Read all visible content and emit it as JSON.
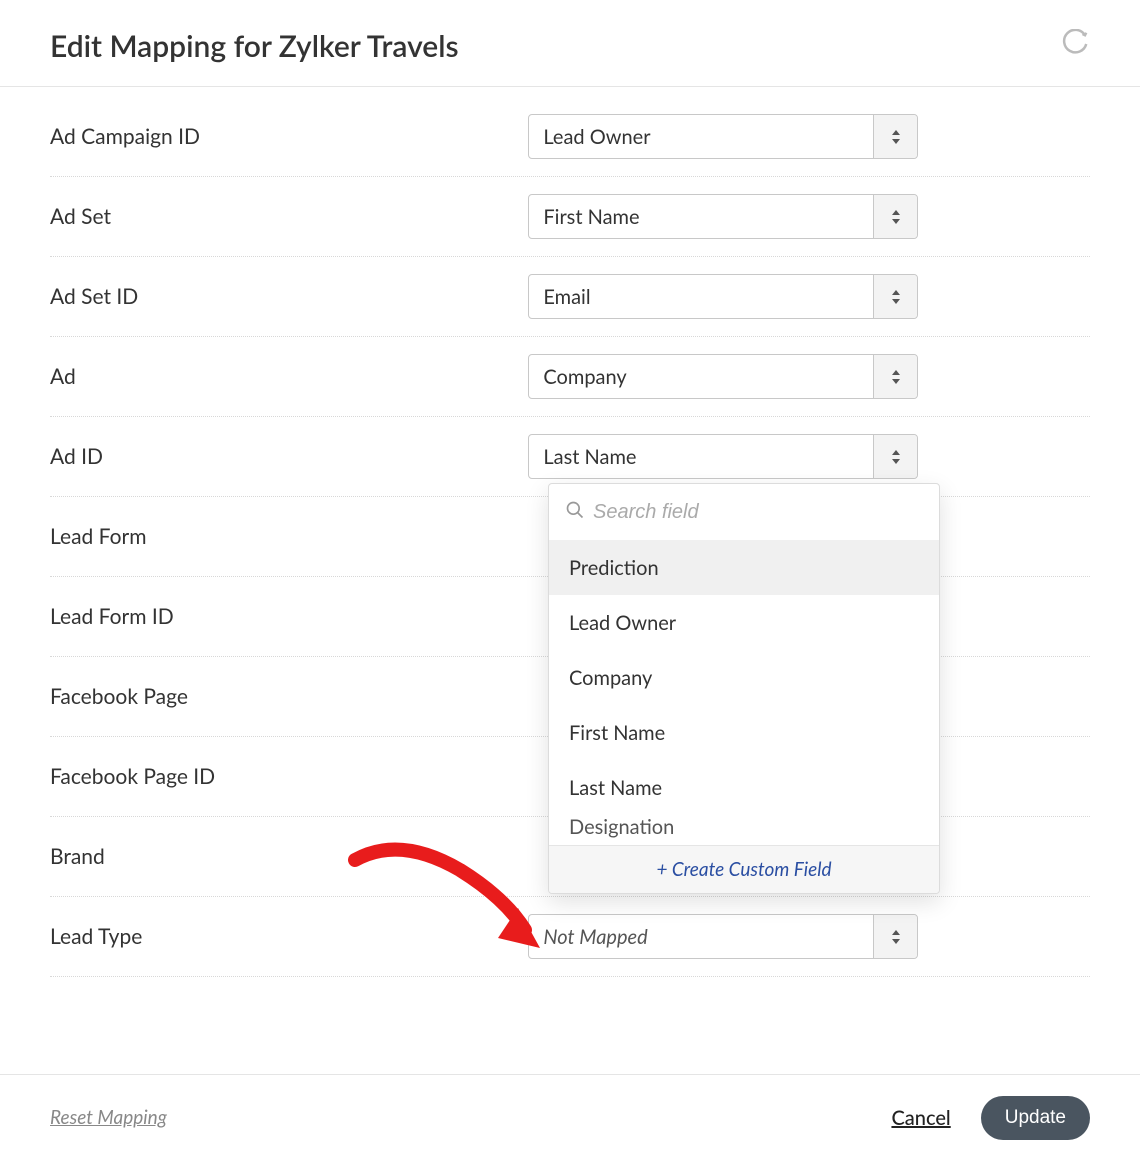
{
  "header": {
    "title": "Edit Mapping for Zylker Travels"
  },
  "rows": [
    {
      "label": "Ad Campaign ID",
      "value": "Lead Owner",
      "mapped": true
    },
    {
      "label": "Ad Set",
      "value": "First Name",
      "mapped": true
    },
    {
      "label": "Ad Set ID",
      "value": "Email",
      "mapped": true
    },
    {
      "label": "Ad",
      "value": "Company",
      "mapped": true
    },
    {
      "label": "Ad ID",
      "value": "Last Name",
      "mapped": true
    },
    {
      "label": "Lead Form",
      "value": null,
      "mapped": false
    },
    {
      "label": "Lead Form ID",
      "value": null,
      "mapped": false
    },
    {
      "label": "Facebook Page",
      "value": null,
      "mapped": false
    },
    {
      "label": "Facebook Page ID",
      "value": null,
      "mapped": false
    },
    {
      "label": "Brand",
      "value": null,
      "mapped": false
    },
    {
      "label": "Lead Type",
      "value": "Not Mapped",
      "mapped": false
    }
  ],
  "dropdown": {
    "search_placeholder": "Search field",
    "options": [
      "Prediction",
      "Lead Owner",
      "Company",
      "First Name",
      "Last Name",
      "Designation"
    ],
    "highlighted_index": 0,
    "create_label": "+ Create Custom Field"
  },
  "footer": {
    "reset": "Reset Mapping",
    "cancel": "Cancel",
    "update": "Update"
  }
}
